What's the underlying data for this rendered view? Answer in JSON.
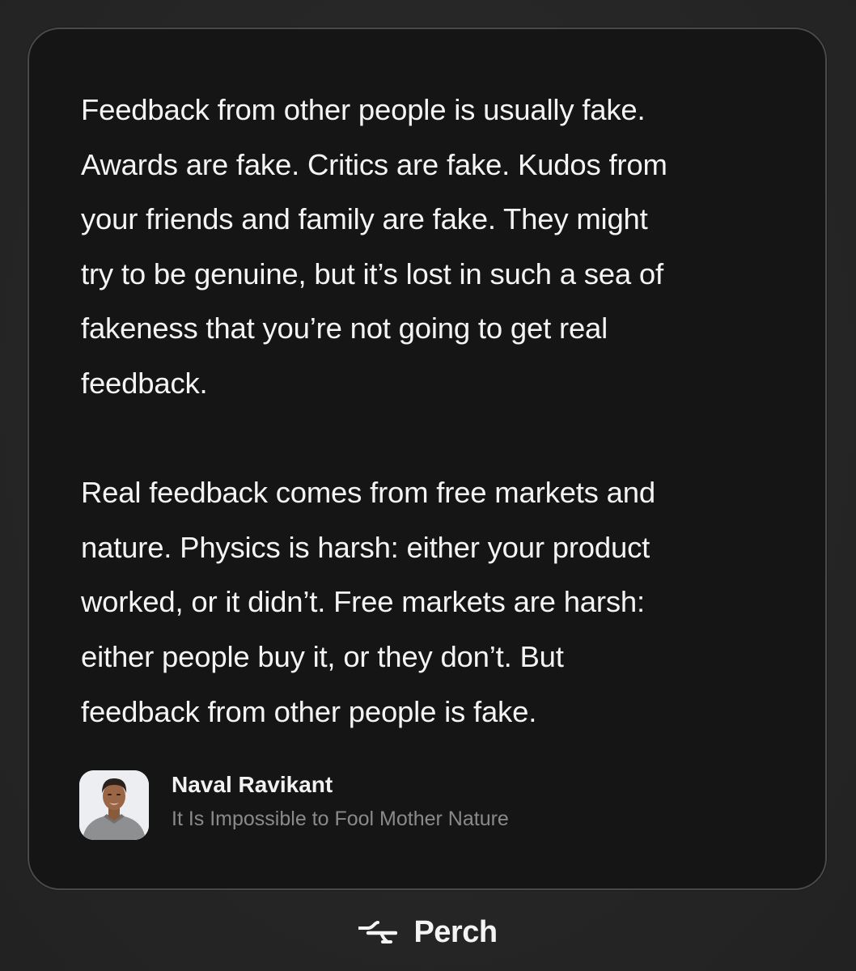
{
  "quote": {
    "paragraphs": [
      "Feedback from other people is usually fake.\nAwards are fake. Critics are fake. Kudos from\nyour friends and family are fake. They might\ntry to be genuine, but it’s lost in such a sea of\nfakeness that you’re not going to get real\nfeedback.",
      "Real feedback comes from free markets and\nnature. Physics is harsh: either your product\nworked, or it didn’t. Free markets are harsh:\neither people buy it, or they don’t. But\nfeedback from other people is fake."
    ]
  },
  "attribution": {
    "author": "Naval Ravikant",
    "source": "It Is Impossible to Fool Mother Nature",
    "avatar_icon": "author-avatar"
  },
  "brand": {
    "name": "Perch",
    "logo_icon": "perch-logo-icon"
  },
  "colors": {
    "background": "#262626",
    "card": "#151515",
    "card_border": "#4a4a4a",
    "text": "#f4f4f4",
    "muted_text": "#8a8a8a"
  }
}
